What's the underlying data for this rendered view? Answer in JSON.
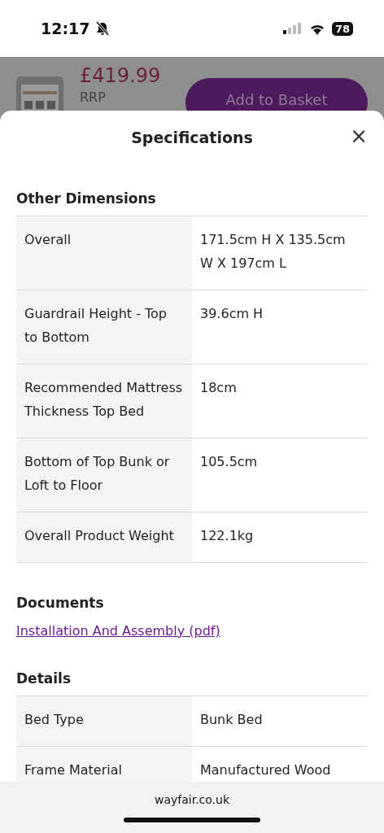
{
  "status_bar": {
    "time": "12:17",
    "battery": "78"
  },
  "product_bar": {
    "price": "£419.99",
    "rrp": "RRP",
    "button": "Add to Basket"
  },
  "sheet": {
    "title": "Specifications",
    "close": "×",
    "sections": [
      {
        "kind": "table",
        "title": "Other Dimensions",
        "rows": [
          {
            "label": "Overall",
            "value": "171.5cm H X 135.5cm W X 197cm L"
          },
          {
            "label": "Guardrail Height - Top to Bottom",
            "value": "39.6cm H"
          },
          {
            "label": "Recommended Mattress Thickness Top Bed",
            "value": "18cm"
          },
          {
            "label": "Bottom of Top Bunk or Loft to Floor",
            "value": "105.5cm"
          },
          {
            "label": "Overall Product Weight",
            "value": "122.1kg"
          }
        ]
      },
      {
        "kind": "links",
        "title": "Documents",
        "links": [
          "Installation And Assembly (pdf)"
        ]
      },
      {
        "kind": "table",
        "title": "Details",
        "rows": [
          {
            "label": "Bed Type",
            "value": "Bunk Bed"
          },
          {
            "label": "Frame Material",
            "value": "Manufactured Wood"
          }
        ]
      }
    ]
  },
  "browser_bar": {
    "url": "wayfair.co.uk"
  }
}
